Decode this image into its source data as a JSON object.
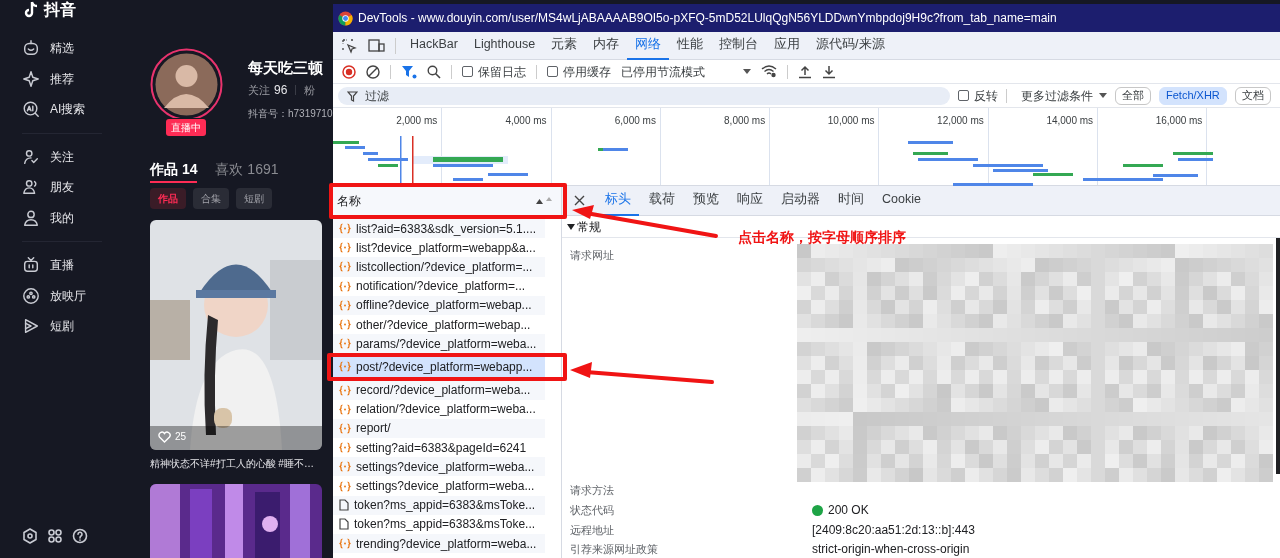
{
  "app": {
    "logo": "抖音",
    "nav_groups": [
      [
        {
          "kind": "smile",
          "label": "精选"
        },
        {
          "kind": "sparkle",
          "label": "推荐"
        },
        {
          "kind": "ai",
          "label": "AI搜索"
        }
      ],
      [
        {
          "kind": "follow",
          "label": "关注"
        },
        {
          "kind": "friends",
          "label": "朋友"
        },
        {
          "kind": "person",
          "label": "我的"
        }
      ],
      [
        {
          "kind": "tv",
          "label": "直播"
        },
        {
          "kind": "reel",
          "label": "放映厅"
        },
        {
          "kind": "play",
          "label": "短剧"
        }
      ]
    ],
    "profile": {
      "name": "每天吃三顿",
      "live_badge": "直播中",
      "following_label": "关注",
      "following": "96",
      "fans_label": "粉",
      "account_id": "抖音号：h7319710"
    },
    "tabs": [
      {
        "label": "作品 14",
        "selected": true
      },
      {
        "label": "喜欢 1691",
        "selected": false
      }
    ],
    "chips": [
      {
        "label": "作品",
        "selected": true
      },
      {
        "label": "合集",
        "selected": false
      },
      {
        "label": "短剧",
        "selected": false
      }
    ],
    "videos": [
      {
        "kind": "picture",
        "likes": "25",
        "caption": "精神状态不详#打工人的心酸 #睡不…"
      },
      {
        "kind": "picture"
      }
    ]
  },
  "devtools": {
    "title": "DevTools - www.douyin.com/user/MS4wLjABAAAAB9OI5o-pXFQ-5mD52LUlqQgN56YLDDwnYmbpdoj9H9c?from_tab_name=main",
    "panel_tabs": [
      {
        "label": "HackBar",
        "selected": false
      },
      {
        "label": "Lighthouse",
        "selected": false
      },
      {
        "label": "元素",
        "selected": false
      },
      {
        "label": "内存",
        "selected": false
      },
      {
        "label": "网络",
        "selected": true
      },
      {
        "label": "性能",
        "selected": false
      },
      {
        "label": "控制台",
        "selected": false
      },
      {
        "label": "应用",
        "selected": false
      },
      {
        "label": "源代码/来源",
        "selected": false
      }
    ],
    "toolbar": {
      "preserve_log": {
        "label": "保留日志",
        "checked": false
      },
      "disable_cache": {
        "label": "停用缓存",
        "checked": false
      },
      "throttling": "已停用节流模式"
    },
    "filter": {
      "placeholder": "过滤",
      "invert": {
        "label": "反转",
        "checked": false
      },
      "more_filters": "更多过滤条件",
      "types": [
        {
          "label": "全部",
          "selected": false
        },
        {
          "label": "Fetch/XHR",
          "selected": true
        },
        {
          "label": "文档",
          "selected": false
        }
      ]
    },
    "timeline_ticks": [
      "2,000 ms",
      "4,000 ms",
      "6,000 ms",
      "8,000 ms",
      "10,000 ms",
      "12,000 ms",
      "14,000 ms",
      "16,000 ms"
    ],
    "requests": {
      "header": "名称",
      "rows": [
        {
          "name": "list?aid=6383&sdk_version=5.1....",
          "kind": "fetch",
          "selected": false
        },
        {
          "name": "list?device_platform=webapp&a...",
          "kind": "fetch",
          "selected": false
        },
        {
          "name": "listcollection/?device_platform=...",
          "kind": "fetch",
          "selected": false
        },
        {
          "name": "notification/?device_platform=...",
          "kind": "fetch",
          "selected": false
        },
        {
          "name": "offline?device_platform=webap...",
          "kind": "fetch",
          "selected": false
        },
        {
          "name": "other/?device_platform=webap...",
          "kind": "fetch",
          "selected": false
        },
        {
          "name": "params/?device_platform=weba...",
          "kind": "fetch",
          "selected": false
        },
        {
          "name": "post/?device_platform=webapp...",
          "kind": "fetch",
          "selected": true
        },
        {
          "name": "record/?device_platform=weba...",
          "kind": "fetch",
          "selected": false
        },
        {
          "name": "relation/?device_platform=weba...",
          "kind": "fetch",
          "selected": false
        },
        {
          "name": "report/",
          "kind": "fetch",
          "selected": false
        },
        {
          "name": "setting?aid=6383&pageId=6241",
          "kind": "fetch",
          "selected": false
        },
        {
          "name": "settings?device_platform=weba...",
          "kind": "fetch",
          "selected": false
        },
        {
          "name": "settings?device_platform=weba...",
          "kind": "fetch",
          "selected": false
        },
        {
          "name": "token?ms_appid=6383&msToke...",
          "kind": "doc",
          "selected": false
        },
        {
          "name": "token?ms_appid=6383&msToke...",
          "kind": "doc",
          "selected": false
        },
        {
          "name": "trending?device_platform=weba...",
          "kind": "fetch",
          "selected": false
        }
      ]
    },
    "detail_tabs": [
      {
        "label": "标头",
        "selected": true
      },
      {
        "label": "载荷",
        "selected": false
      },
      {
        "label": "预览",
        "selected": false
      },
      {
        "label": "响应",
        "selected": false
      },
      {
        "label": "启动器",
        "selected": false
      },
      {
        "label": "时间",
        "selected": false
      },
      {
        "label": "Cookie",
        "selected": false
      }
    ],
    "section": {
      "title": "常规",
      "expanded": true
    },
    "fields": [
      {
        "label": "请求网址",
        "redacted": true
      },
      {
        "label": "请求方法",
        "redacted": true
      },
      {
        "label": "状态代码",
        "value": "200 OK",
        "color": "#1ea446"
      },
      {
        "label": "远程地址",
        "value": "[2409:8c20:aa51:2d:13::b]:443"
      },
      {
        "label": "引荐来源网址政策",
        "value": "strict-origin-when-cross-origin"
      }
    ]
  },
  "annotation": {
    "note": "点击名称，按字母顺序排序"
  }
}
